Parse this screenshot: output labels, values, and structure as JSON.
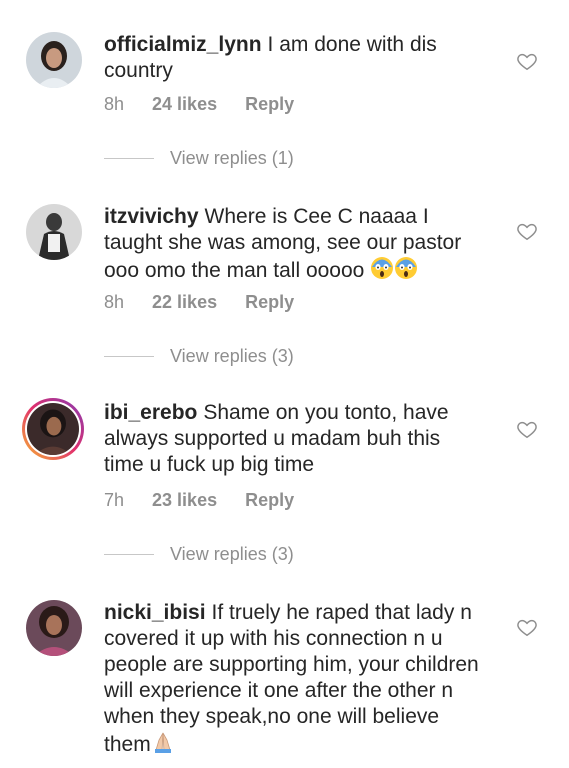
{
  "comments": [
    {
      "username": "officialmiz_lynn",
      "text": "I am done with dis country",
      "time": "8h",
      "likes": "24 likes",
      "reply": "Reply",
      "view_replies": "View replies (1)"
    },
    {
      "username": "itzvivichy",
      "text": "Where is Cee C naaaa I taught she was among, see our pastor ooo omo the man tall ooooo",
      "time": "8h",
      "likes": "22 likes",
      "reply": "Reply",
      "view_replies": "View replies (3)"
    },
    {
      "username": "ibi_erebo",
      "text": "Shame on you tonto, have always supported u madam buh this time u fuck up big time",
      "time": "7h",
      "likes": "23 likes",
      "reply": "Reply",
      "view_replies": "View replies (3)"
    },
    {
      "username": "nicki_ibisi",
      "text": "If truely he raped that lady n covered it up with his connection n u people are supporting him, your children will experience it one after the other n when they speak,no one will believe them",
      "time": "",
      "likes": "",
      "reply": "",
      "view_replies": ""
    }
  ],
  "icons": {
    "like": "heart-outline-icon",
    "scream_emoji": "face-screaming-in-fear-emoji",
    "pray_emoji": "folded-hands-emoji"
  },
  "colors": {
    "text": "#262626",
    "muted": "#8e8e8e",
    "story_ring_start": "#f7b733",
    "story_ring_end": "#833ab4"
  }
}
